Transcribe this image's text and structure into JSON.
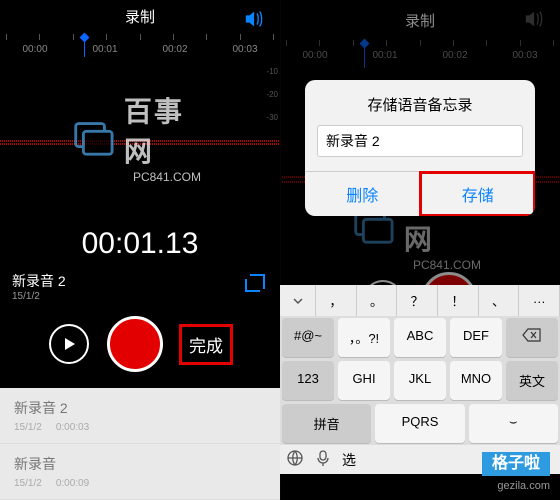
{
  "header": {
    "title": "录制"
  },
  "ruler": {
    "labels": [
      "00:00",
      "00:01",
      "00:02",
      "00:03"
    ]
  },
  "wave": {
    "scale": [
      "-10",
      "-20",
      "-30",
      "-10",
      "-20",
      "-30"
    ]
  },
  "watermark": {
    "big": "百事网",
    "small": "PC841.COM"
  },
  "bigtime": "00:01.13",
  "current": {
    "name": "新录音 2",
    "date": "15/1/2"
  },
  "done_label": "完成",
  "list": [
    {
      "name": "新录音 2",
      "date": "15/1/2",
      "dur": "0:00:03"
    },
    {
      "name": "新录音",
      "date": "15/1/2",
      "dur": "0:00:09"
    }
  ],
  "dialog": {
    "title": "存储语音备忘录",
    "input_value": "新录音 2",
    "delete_label": "删除",
    "save_label": "存储"
  },
  "keyboard": {
    "suggest": [
      "，",
      "。",
      "？",
      "！",
      "、",
      "…"
    ],
    "rows": [
      [
        "#@~",
        "，。?!",
        "ABC",
        "DEF"
      ],
      [
        "123",
        "GHI",
        "JKL",
        "MNO"
      ],
      [
        "拼音",
        "PQRS",
        "⌣",
        ""
      ]
    ],
    "side": [
      "",
      "英文",
      ""
    ],
    "select_label": "选"
  },
  "corners": {
    "right_label": "格子啦",
    "right_url": "gezila.com"
  }
}
